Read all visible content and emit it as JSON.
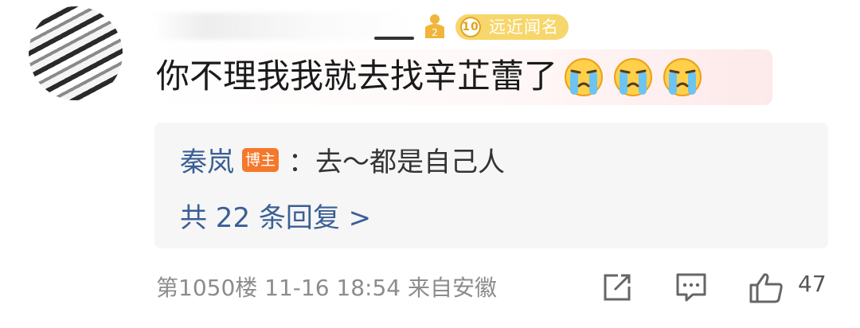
{
  "comment": {
    "user_badge": {
      "level": "10",
      "label": "远近闻名"
    },
    "text": "你不理我我就去找辛芷蕾了",
    "emojis": [
      "crying-emoji",
      "crying-emoji",
      "crying-emoji"
    ]
  },
  "reply": {
    "author": "秦岚",
    "author_badge": "博主",
    "text": "：去～都是自己人",
    "count_text": "共 22 条回复 >"
  },
  "meta": {
    "floor_time_location": "第1050楼 11-16 18:54 来自安徽",
    "like_count": "47"
  },
  "colors": {
    "link_blue": "#3b5f95",
    "badge_gold": "#f7d66b",
    "host_orange": "#f5782b",
    "meta_gray": "#8c8c8c"
  }
}
